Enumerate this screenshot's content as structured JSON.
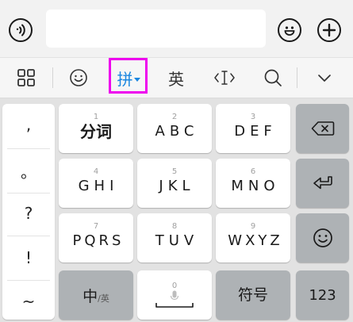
{
  "input_bar": {
    "text_value": "",
    "placeholder": ""
  },
  "toolbar": {
    "pinyin_label": "拼",
    "english_label": "英"
  },
  "left_column": {
    "items": [
      ",",
      "。",
      "?",
      "!",
      "~"
    ]
  },
  "keys": {
    "row1": [
      {
        "num": "1",
        "label": "分词"
      },
      {
        "num": "2",
        "label": "ABC"
      },
      {
        "num": "3",
        "label": "DEF"
      }
    ],
    "row2": [
      {
        "num": "4",
        "label": "GHI"
      },
      {
        "num": "5",
        "label": "JKL"
      },
      {
        "num": "6",
        "label": "MNO"
      }
    ],
    "row3": [
      {
        "num": "7",
        "label": "PQRS"
      },
      {
        "num": "8",
        "label": "TUV"
      },
      {
        "num": "9",
        "label": "WXYZ"
      }
    ],
    "bottom": {
      "lang_main": "中",
      "lang_sub": "/英",
      "space_num": "0",
      "symbols": "符号",
      "numeric": "123"
    }
  },
  "colors": {
    "highlight": "#ee00ee",
    "accent": "#1a86e0",
    "function_key": "#aeb2b5"
  }
}
